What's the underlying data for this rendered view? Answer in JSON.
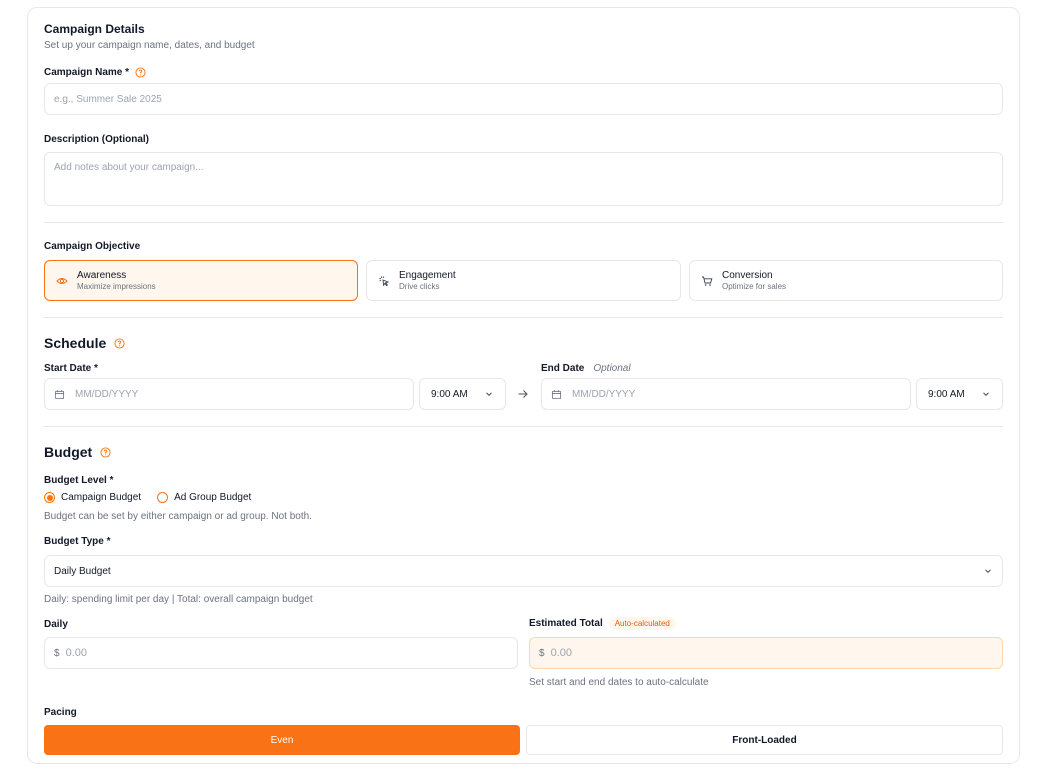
{
  "campaign_details": {
    "title": "Campaign Details",
    "subtitle": "Set up your campaign name, dates, and budget",
    "name_label": "Campaign Name *",
    "name_placeholder": "e.g., Summer Sale 2025",
    "description_label": "Description (Optional)",
    "description_placeholder": "Add notes about your campaign..."
  },
  "objective": {
    "label": "Campaign Objective",
    "options": [
      {
        "title": "Awareness",
        "subtitle": "Maximize impressions",
        "icon": "eye-icon",
        "selected": true
      },
      {
        "title": "Engagement",
        "subtitle": "Drive clicks",
        "icon": "cursor-click-icon",
        "selected": false
      },
      {
        "title": "Conversion",
        "subtitle": "Optimize for sales",
        "icon": "cart-icon",
        "selected": false
      }
    ]
  },
  "schedule": {
    "title": "Schedule",
    "start_label": "Start Date *",
    "start_placeholder": "MM/DD/YYYY",
    "start_time": "9:00 AM",
    "end_label": "End Date",
    "end_optional": "Optional",
    "end_placeholder": "MM/DD/YYYY",
    "end_time": "9:00 AM"
  },
  "budget": {
    "title": "Budget",
    "level_label": "Budget Level *",
    "level_options": [
      "Campaign Budget",
      "Ad Group Budget"
    ],
    "level_selected": "Campaign Budget",
    "level_hint": "Budget can be set by either campaign or ad group. Not both.",
    "type_label": "Budget Type *",
    "type_value": "Daily Budget",
    "type_hint": "Daily: spending limit per day | Total: overall campaign budget",
    "daily_label": "Daily",
    "daily_currency": "$",
    "daily_placeholder": "0.00",
    "estimated_label": "Estimated Total",
    "estimated_badge": "Auto-calculated",
    "estimated_currency": "$",
    "estimated_placeholder": "0.00",
    "estimated_hint": "Set start and end dates to auto-calculate",
    "pacing_label": "Pacing",
    "pacing_options": [
      "Even",
      "Front-Loaded"
    ],
    "pacing_selected": "Even"
  },
  "colors": {
    "accent": "#f97316",
    "accent_light": "#fff7ed",
    "border": "#e5e7eb",
    "muted_text": "#6b7280"
  }
}
